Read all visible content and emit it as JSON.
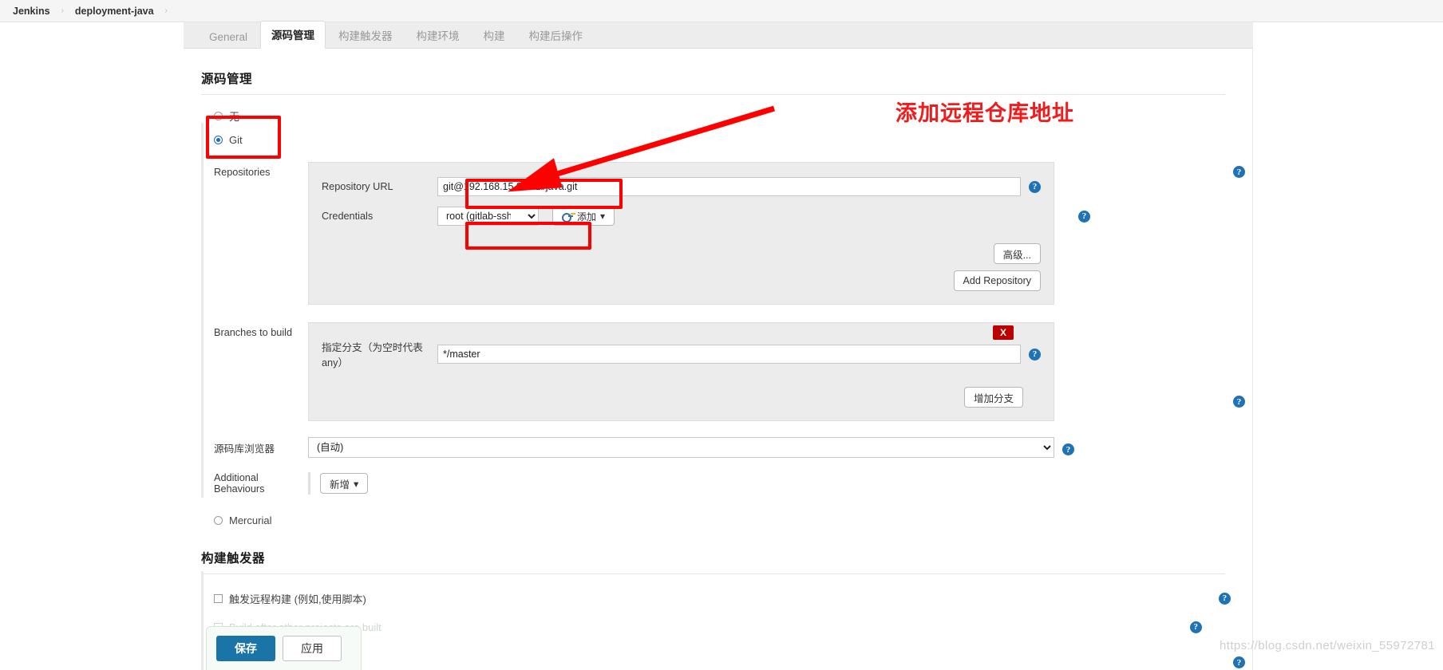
{
  "breadcrumb": {
    "items": [
      {
        "label": "Jenkins"
      },
      {
        "label": "deployment-java"
      }
    ],
    "separator": "›"
  },
  "tabs": [
    {
      "label": "General",
      "active": false
    },
    {
      "label": "源码管理",
      "active": true
    },
    {
      "label": "构建触发器",
      "active": false
    },
    {
      "label": "构建环境",
      "active": false
    },
    {
      "label": "构建",
      "active": false
    },
    {
      "label": "构建后操作",
      "active": false
    }
  ],
  "scm": {
    "section_title": "源码管理",
    "options": [
      {
        "label": "无",
        "checked": false
      },
      {
        "label": "Git",
        "checked": true
      },
      {
        "label": "Mercurial",
        "checked": false
      }
    ],
    "repositories": {
      "label": "Repositories",
      "repository_url_label": "Repository URL",
      "repository_url_value": "git@192.168.15.99:hzl/java.git",
      "credentials_label": "Credentials",
      "credentials_value": "root (gitlab-ssh-key)",
      "add_credentials_label": "添加",
      "advanced_label": "高级...",
      "add_repository_label": "Add Repository"
    },
    "branches": {
      "label": "Branches to build",
      "branch_specifier_label": "指定分支（为空时代表any）",
      "branch_specifier_value": "*/master",
      "delete_label": "X",
      "add_branch_label": "增加分支"
    },
    "browser": {
      "label": "源码库浏览器",
      "value": "(自动)"
    },
    "additional_behaviours": {
      "label": "Additional Behaviours",
      "add_label": "新增"
    }
  },
  "triggers": {
    "section_title": "构建触发器",
    "remote_trigger_label": "触发远程构建 (例如,使用脚本)",
    "build_after_label": "Build after other projects are built"
  },
  "footer": {
    "save_label": "保存",
    "apply_label": "应用"
  },
  "annotation": {
    "text": "添加远程仓库地址",
    "color": "#f21b1b"
  },
  "watermark": "https://blog.csdn.net/weixin_55972781",
  "icons": {
    "help": "?",
    "key": "key-icon",
    "caret": "▾"
  }
}
